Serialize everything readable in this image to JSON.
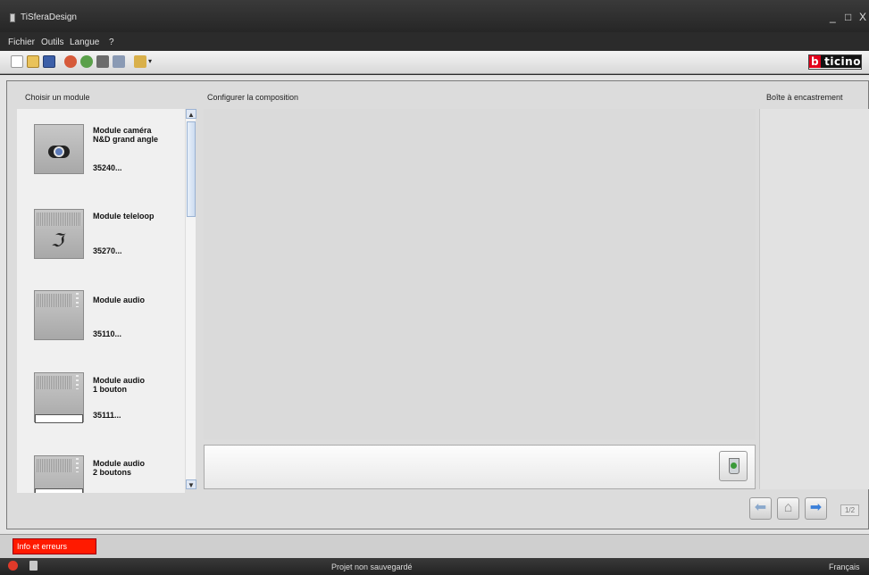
{
  "window": {
    "title": "TiSferaDesign",
    "minimize": "_",
    "maximize": "□",
    "close": "X"
  },
  "menu": [
    "Fichier",
    "Outils",
    "Langue",
    "?"
  ],
  "toolbar": {
    "icons": [
      "new-file-icon",
      "open-folder-icon",
      "save-icon",
      "import-icon",
      "export-icon",
      "settings-icon",
      "print-icon",
      "language-icon",
      "dropdown-arrow-icon"
    ],
    "logo_b": "b",
    "logo_rest": "ticino"
  },
  "panels": {
    "modules_title": "Choisir un module",
    "compose_title": "Configurer la composition",
    "box_title": "Boîte à encastrement"
  },
  "modules": [
    {
      "name": "Module caméra\nN&D grand angle",
      "ref": "35240..."
    },
    {
      "name": "Module teleloop",
      "ref": "35270..."
    },
    {
      "name": "Module audio",
      "ref": "35110..."
    },
    {
      "name": "Module audio\n1 bouton",
      "ref": "35111..."
    },
    {
      "name": "Module audio\n2 boutons",
      "ref": ""
    }
  ],
  "navigation": {
    "back_icon": "arrow-left-icon",
    "home_icon": "home-icon",
    "next_icon": "arrow-right-icon",
    "page": "1/2"
  },
  "errors_button": "Info et erreurs",
  "status": {
    "message": "Projet non sauvegardé",
    "language": "Français"
  },
  "colors": {
    "error_red": "#ff1a00",
    "brand_red": "#e2001a",
    "scroll_blue": "#9bb3d3"
  }
}
